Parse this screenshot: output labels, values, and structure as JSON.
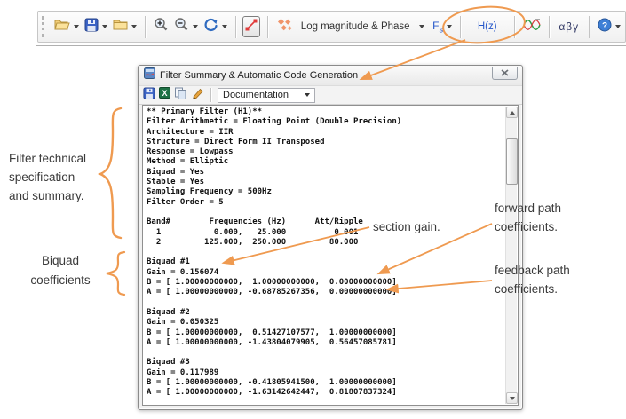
{
  "colors": {
    "annotation_orange": "#EF9A50",
    "toolbar_blue": "#2456c9",
    "plot_red": "#e03a3a",
    "excel_green": "#1e7145",
    "save_blue": "#3a62c4"
  },
  "top_toolbar": {
    "icons": [
      "open-file",
      "save",
      "folder",
      "zoom-in",
      "zoom-out",
      "refresh",
      "line-plot-toggle",
      "sparkle-markers",
      "analysis-wave",
      "help"
    ],
    "analysis_dropdown_value": "Log magnitude & Phase",
    "fs_button_main": "F",
    "fs_button_sub": "s",
    "hz_button_label": "H(z)",
    "greek_button_label": "αβγ"
  },
  "window": {
    "title": "Filter Summary & Automatic Code Generation",
    "toolbar_icons": [
      "save",
      "export-excel",
      "copy",
      "edit-pencil"
    ],
    "doc_dropdown_value": "Documentation",
    "report_lines": [
      "** Primary Filter (H1)**",
      "Filter Arithmetic = Floating Point (Double Precision)",
      "Architecture = IIR",
      "Structure = Direct Form II Transposed",
      "Response = Lowpass",
      "Method = Elliptic",
      "Biquad = Yes",
      "Stable = Yes",
      "Sampling Frequency = 500Hz",
      "Filter Order = 5",
      "",
      "Band#        Frequencies (Hz)      Att/Ripple",
      "  1           0.000,   25.000          0.001",
      "  2         125.000,  250.000         80.000",
      "",
      "Biquad #1",
      "Gain = 0.156074",
      "B = [ 1.00000000000,  1.00000000000,  0.00000000000]",
      "A = [ 1.00000000000, -0.68785267356,  0.00000000000]",
      "",
      "Biquad #2",
      "Gain = 0.050325",
      "B = [ 1.00000000000,  0.51427107577,  1.00000000000]",
      "A = [ 1.00000000000, -1.43804079905,  0.56457085781]",
      "",
      "Biquad #3",
      "Gain = 0.117989",
      "B = [ 1.00000000000, -0.41805941500,  1.00000000000]",
      "A = [ 1.00000000000, -1.63142642447,  0.81807837324]"
    ]
  },
  "annotations": {
    "filter_spec": [
      "Filter technical",
      "specification",
      "and summary."
    ],
    "biquad": [
      "Biquad",
      "coefficients"
    ],
    "section_gain": "section gain.",
    "forward_path": [
      "forward path",
      "coefficients."
    ],
    "feedback_path": [
      "feedback path",
      "coefficients."
    ]
  }
}
